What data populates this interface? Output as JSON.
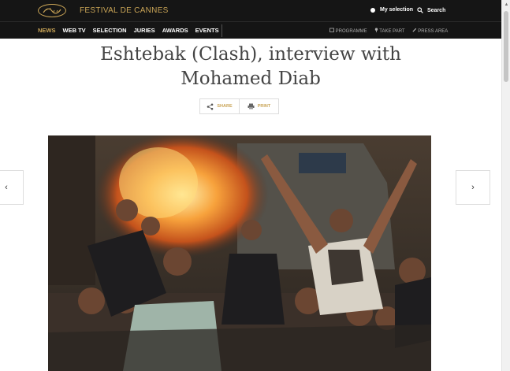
{
  "header": {
    "brand": "FESTIVAL DE CANNES",
    "my_selection": "My selection",
    "search": "Search"
  },
  "nav": {
    "items": [
      "NEWS",
      "WEB TV",
      "SELECTION",
      "JURIES",
      "AWARDS",
      "EVENTS"
    ],
    "active": "NEWS",
    "right": [
      "PROGRAMME",
      "TAKE PART",
      "PRESS AREA"
    ]
  },
  "article": {
    "title_line1": "Eshtebak (Clash), interview with",
    "title_line2": "Mohamed Diab",
    "share": "SHARE",
    "print": "PRINT"
  },
  "carousel": {
    "prev": "‹",
    "next": "›"
  },
  "colors": {
    "header_bg": "#151515",
    "accent": "#c9a456",
    "title": "#444444"
  },
  "icons": [
    "cannes-logo-icon",
    "circle-icon",
    "search-icon",
    "calendar-icon",
    "pin-icon",
    "pencil-icon",
    "share-icon",
    "print-icon",
    "chevron-left-icon",
    "chevron-right-icon"
  ]
}
